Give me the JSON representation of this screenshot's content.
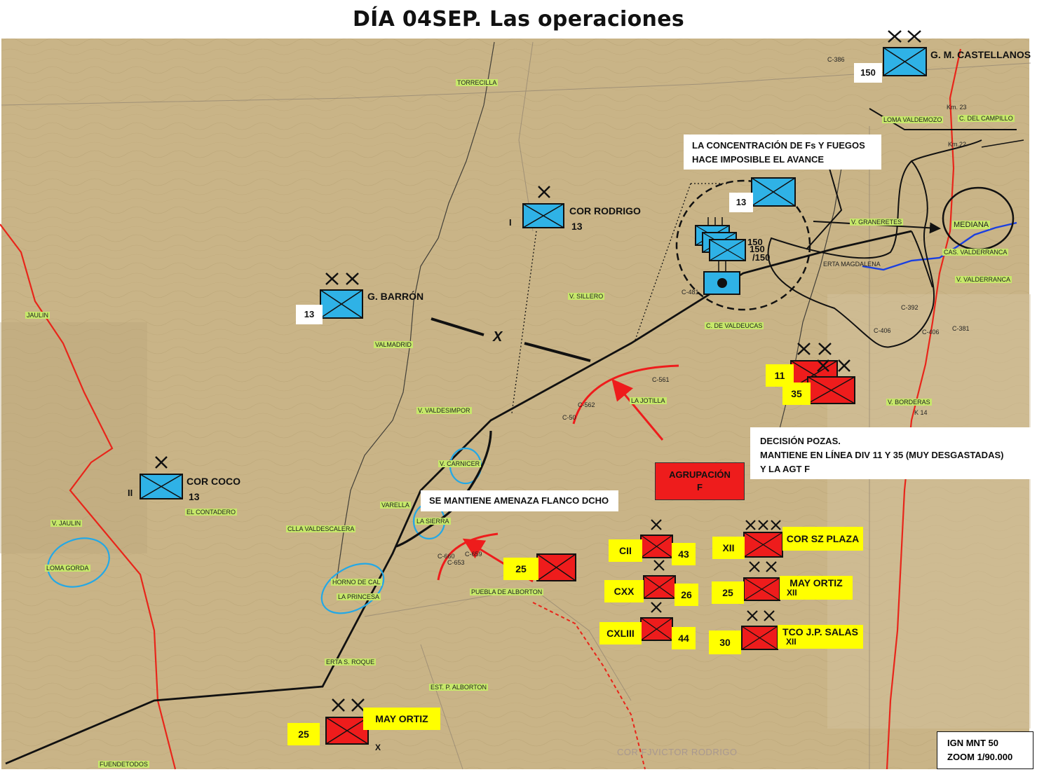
{
  "title": "DÍA 04SEP. Las operaciones",
  "colors": {
    "map_background": "#c9b487",
    "friendly_unit": "#2fb2e6",
    "enemy_unit": "#ee1c1c",
    "label_yellow": "#ffff00",
    "road_red": "#e8251a",
    "river_blue": "#1a3fe0"
  },
  "notes": {
    "concentration_line1": "LA CONCENTRACIÓN DE Fs Y FUEGOS",
    "concentration_line2": "HACE IMPOSIBLE EL AVANCE",
    "decision_line1": "DECISIÓN POZAS.",
    "decision_line2": "MANTIENE EN LÍNEA DIV 11 Y 35 (MUY DESGASTADAS)",
    "decision_line3": "Y LA AGT F",
    "threat": "SE MANTIENE AMENAZA FLANCO DCHO"
  },
  "friendly_units": {
    "castellanos": {
      "name": "G. M. CASTELLANOS",
      "number": "150",
      "echelon": "XX"
    },
    "rodrigo": {
      "name": "COR RODRIGO",
      "number": "13",
      "prefix": "I",
      "echelon": "X"
    },
    "barron": {
      "name": "G. BARRÓN",
      "number": "13",
      "echelon": "XX"
    },
    "coco": {
      "name": "COR COCO",
      "number": "13",
      "prefix": "II",
      "echelon": "X"
    },
    "concentration_top": {
      "number": "13"
    },
    "stack": {
      "n1": "150",
      "n2": "150",
      "n3": "/150"
    }
  },
  "enemy_units": {
    "div11": {
      "number": "11",
      "echelon": "XX"
    },
    "div35": {
      "number": "35",
      "echelon": "XX"
    },
    "agt_line1": "AGRUPACIÓN",
    "agt_line2": "F",
    "div25_mid": {
      "number": "25"
    },
    "cii": {
      "roman": "CII",
      "number": "43",
      "echelon": "X"
    },
    "cxx": {
      "roman": "CXX",
      "number": "26",
      "echelon": "X"
    },
    "cxliii": {
      "roman": "CXLIII",
      "number": "44",
      "echelon": "X"
    },
    "sz_plaza": {
      "roman": "XII",
      "name": "COR SZ PLAZA",
      "echelon": "XXX"
    },
    "may_ortiz_right": {
      "number": "25",
      "name": "MAY  ORTIZ",
      "roman": "XII",
      "echelon": "XX"
    },
    "jp_salas": {
      "number": "30",
      "name": "TCO J.P. SALAS",
      "roman": "XII",
      "echelon": "XX"
    },
    "may_ortiz_bottom": {
      "number": "25",
      "name": "MAY  ORTIZ",
      "roman": "X",
      "echelon": "XX"
    }
  },
  "boundary_label": "X",
  "places": {
    "torrecilla": "TORRECILLA",
    "jaulin": "JAULIN",
    "valmadrid": "VALMADRID",
    "v_sillero": "V. SILLERO",
    "c_valdeucas": "C. DE VALDEUCAS",
    "v_valdesimpor": "V. VALDESIMPOR",
    "la_jotilla": "LA JOTILLA",
    "v_carnicer": "V. CARNICER",
    "varella": "VARELLA",
    "la_sierra": "LA SIERRA",
    "el_contadero": "EL CONTADERO",
    "v_jaulin": "V. JAULIN",
    "loma_gorda": "LOMA GORDA",
    "clla_valdescalera": "CLLA VALDESCALERA",
    "horno_cal": "HORNO DE CAL",
    "la_princesa": "LA PRINCESA",
    "puebla_alborton": "PUEBLA DE ALBORTON",
    "erta_roque": "ERTA S. ROQUE",
    "est_alborton": "EST. P. ALBORTON",
    "fuendetodos": "FUENDETODOS",
    "loma_valdemozo": "LOMA VALDEMOZO",
    "c_campillo": "C. DEL CAMPILLO",
    "v_granerete": "V. GRANERETES",
    "mediana": "MEDIANA",
    "cas_valderranca": "CAS. VALDERRANCA",
    "v_valderranca": "V. VALDERRANCA",
    "erta_magdalena": "ERTA MAGDALENA",
    "v_borderas": "V. BORDERAS",
    "km23": "Km. 23",
    "km22": "Km.22",
    "k14": "K 14",
    "c386": "C-386",
    "c481": "C-481",
    "c561": "C-561",
    "c562": "C-562",
    "c50": "C-50",
    "c392": "C-392",
    "c406a": "C-406",
    "c406b": "C-406",
    "c381": "C-381",
    "c653": "C-653",
    "c659": "C-659",
    "c660": "C-660"
  },
  "scale": {
    "line1": "IGN MNT 50",
    "line2": "ZOOM 1/90.000"
  },
  "credit": "COR FJVICTOR RODRIGO"
}
